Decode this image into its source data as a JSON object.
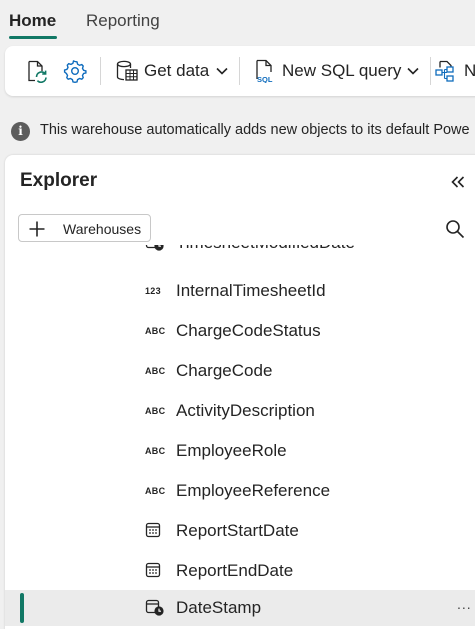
{
  "tabs": [
    {
      "label": "Home",
      "active": true
    },
    {
      "label": "Reporting",
      "active": false
    }
  ],
  "toolbar": {
    "refresh_icon": "refresh-icon",
    "settings_icon": "gear-icon",
    "get_data_label": "Get data",
    "new_sql_query_label": "New SQL query",
    "truncated_label": "N"
  },
  "info": {
    "text": "This warehouse automatically adds new objects to its default Powe"
  },
  "explorer": {
    "title": "Explorer",
    "warehouses_button": "Warehouses",
    "items": [
      {
        "label": "TimesheetModifiedDate",
        "type": "datetime"
      },
      {
        "label": "InternalTimesheetId",
        "type": "number",
        "type_text": "123"
      },
      {
        "label": "ChargeCodeStatus",
        "type": "text",
        "type_text": "ABC"
      },
      {
        "label": "ChargeCode",
        "type": "text",
        "type_text": "ABC"
      },
      {
        "label": "ActivityDescription",
        "type": "text",
        "type_text": "ABC"
      },
      {
        "label": "EmployeeRole",
        "type": "text",
        "type_text": "ABC"
      },
      {
        "label": "EmployeeReference",
        "type": "text",
        "type_text": "ABC"
      },
      {
        "label": "ReportStartDate",
        "type": "date"
      },
      {
        "label": "ReportEndDate",
        "type": "date"
      },
      {
        "label": "DateStamp",
        "type": "datetime",
        "selected": true,
        "more": "..."
      }
    ]
  },
  "colors": {
    "accent": "#117865",
    "background": "#f0f0f0",
    "panel": "#ffffff",
    "selected_row": "#ebebeb"
  }
}
